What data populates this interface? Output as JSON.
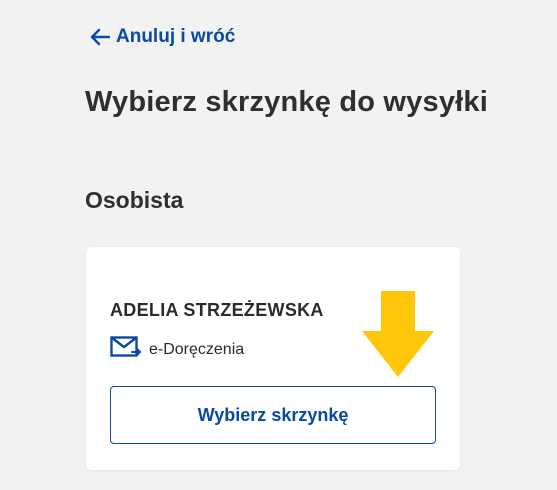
{
  "nav": {
    "back_label": "Anuluj i wróć"
  },
  "page": {
    "title": "Wybierz skrzynkę do wysyłki"
  },
  "section": {
    "title": "Osobista"
  },
  "mailbox_card": {
    "owner_name": "ADELIA STRZEŻEWSKA",
    "service_icon": "envelope-icon",
    "service_label": "e-Doręczenia",
    "select_button_label": "Wybierz skrzynkę"
  },
  "annotation": {
    "icon": "down-arrow-icon",
    "color": "#ffc60a"
  },
  "colors": {
    "link": "#0b4aa2",
    "background": "#f2f2f2",
    "card": "#ffffff",
    "text": "#2b2b2b"
  }
}
